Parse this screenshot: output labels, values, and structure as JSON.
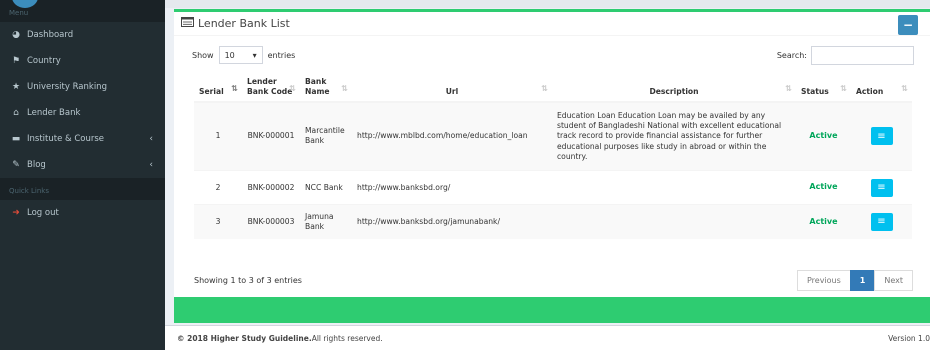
{
  "sidebar": {
    "header_menu": "Menu",
    "items": [
      {
        "label": "Dashboard",
        "icon": "dashboard-icon",
        "glyph": "◕"
      },
      {
        "label": "Country",
        "icon": "flag-icon",
        "glyph": "⚑"
      },
      {
        "label": "University Ranking",
        "icon": "star-icon",
        "glyph": "★"
      },
      {
        "label": "Lender Bank",
        "icon": "bank-icon",
        "glyph": "⌂"
      },
      {
        "label": "Institute & Course",
        "icon": "laptop-icon",
        "glyph": "▬",
        "chevron": "‹"
      },
      {
        "label": "Blog",
        "icon": "edit-icon",
        "glyph": "✎",
        "chevron": "‹"
      }
    ],
    "header_quick": "Quick Links",
    "logout": {
      "label": "Log out",
      "glyph": "➜"
    }
  },
  "box": {
    "title": "Lender Bank List",
    "collapse_label": "−"
  },
  "controls": {
    "show_label": "Show",
    "length_value": "10",
    "entries_label": "entries",
    "search_label": "Search:"
  },
  "table": {
    "headers": [
      "Serial",
      "Lender Bank Code",
      "Bank Name",
      "Url",
      "Description",
      "Status",
      "Action"
    ],
    "rows": [
      {
        "serial": "1",
        "code": "BNK-000001",
        "name": "Marcantile Bank",
        "url": "http://www.mblbd.com/home/education_loan",
        "description": "Education Loan Education Loan may be availed by any student of Bangladeshi National with excellent educational track record to provide financial assistance for further educational purposes like study in abroad or within the country.",
        "status": "Active"
      },
      {
        "serial": "2",
        "code": "BNK-000002",
        "name": "NCC Bank",
        "url": "http://www.banksbd.org/",
        "description": "",
        "status": "Active"
      },
      {
        "serial": "3",
        "code": "BNK-000003",
        "name": "Jamuna Bank",
        "url": "http://www.banksbd.org/jamunabank/",
        "description": "",
        "status": "Active"
      }
    ]
  },
  "info": "Showing 1 to 3 of 3 entries",
  "pager": {
    "previous": "Previous",
    "current": "1",
    "next": "Next"
  },
  "footer": {
    "copyright": "© 2018 Higher Study Guideline.",
    "rights": " All rights reserved.",
    "version": "Version 1.0"
  },
  "colors": {
    "accent": "#2ecc71",
    "primary": "#3c8dbc",
    "info_button": "#00c0ef",
    "active_status": "#00a65a",
    "sidebar": "#222d32"
  }
}
